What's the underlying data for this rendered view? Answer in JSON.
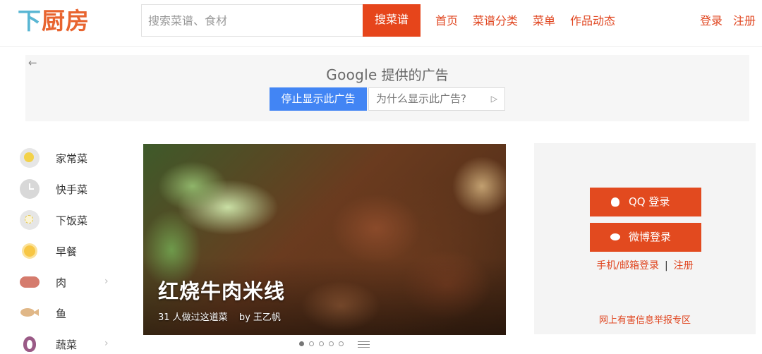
{
  "header": {
    "logo": [
      "下",
      "厨",
      "房"
    ],
    "search_placeholder": "搜索菜谱、食材",
    "search_button": "搜菜谱",
    "nav": [
      "首页",
      "菜谱分类",
      "菜单",
      "作品动态"
    ],
    "login": "登录",
    "register": "注册"
  },
  "ad": {
    "back_arrow": "←",
    "google": "Google",
    "provided": "提供的广告",
    "stop_button": "停止显示此广告",
    "why_button": "为什么显示此广告?",
    "why_icon": "▷"
  },
  "categories": [
    {
      "label": "家常菜",
      "icon": "egg-icon"
    },
    {
      "label": "快手菜",
      "icon": "clock-icon"
    },
    {
      "label": "下饭菜",
      "icon": "rice-icon"
    },
    {
      "label": "早餐",
      "icon": "sun-icon"
    },
    {
      "label": "肉",
      "icon": "pig-icon",
      "arrow": "›"
    },
    {
      "label": "鱼",
      "icon": "fish-icon"
    },
    {
      "label": "蔬菜",
      "icon": "onion-icon",
      "arrow": "›"
    }
  ],
  "slide": {
    "title": "红烧牛肉米线",
    "count_text": "31 人做过这道菜",
    "author_text": "by 王乙帆",
    "total_dots": 5,
    "active_dot": 1
  },
  "login_panel": {
    "qq_button": "QQ 登录",
    "weibo_button": "微博登录",
    "phone_login": "手机/邮箱登录",
    "separator": "|",
    "register": "注册",
    "report": "网上有害信息举报专区"
  },
  "colors": {
    "brand_red": "#e6451b",
    "logo_blue": "#59b6d3",
    "google_blue": "#4285f4"
  }
}
